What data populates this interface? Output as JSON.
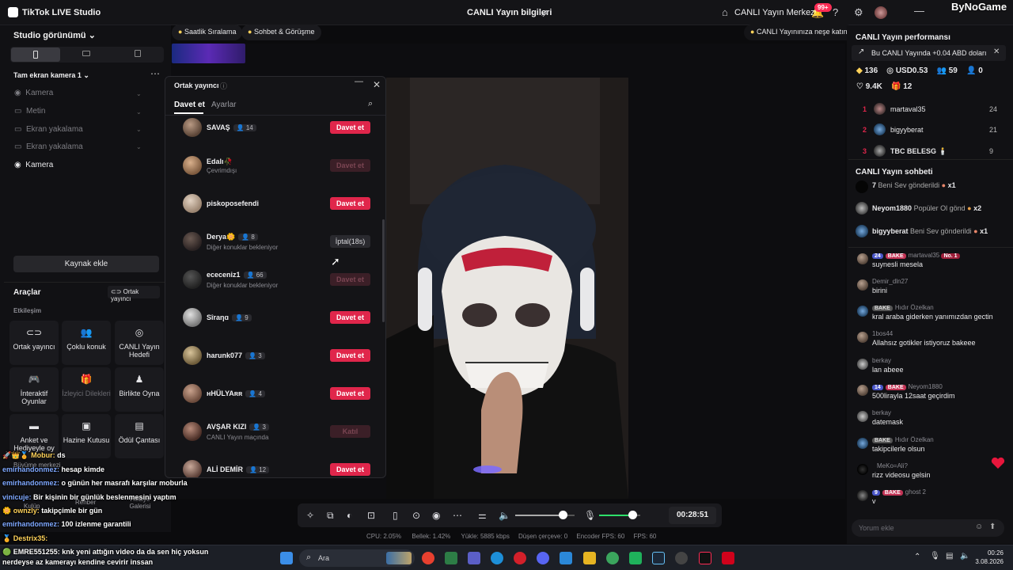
{
  "titlebar": {
    "app_title": "TikTok LIVE Studio",
    "center_title": "CANLI Yayın bilgileri",
    "live_center": "CANLI Yayın Merkezi",
    "notif_badge": "99+",
    "watermark": "ByNoGame"
  },
  "left_panel": {
    "studio_view": "Studio görünümü",
    "scene_name": "Tam ekran kamera 1",
    "sources": [
      "Kamera",
      "Metin",
      "Ekran yakalama",
      "Ekran yakalama",
      "Kamera"
    ],
    "add_source": "Kaynak ekle",
    "tools_title": "Araçlar",
    "cohost_link": "Ortak yayıncı",
    "engagement_title": "Etkileşim",
    "tools": [
      {
        "label": "Ortak yayıncı",
        "icon": "link-icon"
      },
      {
        "label": "Çoklu konuk",
        "icon": "people-icon"
      },
      {
        "label": "CANLI Yayın Hedefi",
        "icon": "target-icon"
      },
      {
        "label": "İnteraktif Oyunlar",
        "icon": "gamepad-icon"
      },
      {
        "label": "İzleyici Dilekleri",
        "icon": "gift-icon"
      },
      {
        "label": "Birlikte Oyna",
        "icon": "controller-icon"
      },
      {
        "label": "Anket ve Hediyeyle oy",
        "icon": "poll-icon"
      },
      {
        "label": "Hazine Kutusu",
        "icon": "chest-icon"
      },
      {
        "label": "Ödül Çantası",
        "icon": "bag-icon"
      }
    ],
    "hidden_tools": [
      "Büyüme merkezi",
      "Kulüp",
      "Rehber",
      "Hediye Galerisi"
    ]
  },
  "top_strip": {
    "hourly_rank": "Saatlik Sıralama",
    "chat_meet": "Sohbet & Görüşme",
    "promo": "CANLI Yayınınıza neşe katın"
  },
  "cohost_dialog": {
    "title": "Ortak yayıncı",
    "tab_invite": "Davet et",
    "tab_settings": "Ayarlar",
    "invite_label": "Davet et",
    "items": [
      {
        "name": "SAVAŞ",
        "count": "14",
        "sub": "",
        "action": "Davet et",
        "state": "active"
      },
      {
        "name": "Edalı🥀",
        "count": "",
        "sub": "Çevrimdışı",
        "action": "Davet et",
        "state": "disabled"
      },
      {
        "name": "piskoposefendi",
        "count": "",
        "sub": "",
        "action": "Davet et",
        "state": "active"
      },
      {
        "name": "Derya🌼",
        "count": "8",
        "sub": "Diğer konuklar bekleniyor",
        "action": "İptal(18s)",
        "state": "cancel"
      },
      {
        "name": "ececeniz1",
        "count": "66",
        "sub": "Diğer konuklar bekleniyor",
        "action": "Davet et",
        "state": "disabled"
      },
      {
        "name": "Sîraηɑ",
        "count": "9",
        "sub": "",
        "action": "Davet et",
        "state": "active"
      },
      {
        "name": "harunk077",
        "count": "3",
        "sub": "",
        "action": "Davet et",
        "state": "active"
      },
      {
        "name": "ʜHÜLYAʀʀ",
        "count": "4",
        "sub": "",
        "action": "Davet et",
        "state": "active"
      },
      {
        "name": "AVŞAR KIZI",
        "count": "3",
        "sub": "CANLI Yayın maçında",
        "action": "Katıl",
        "state": "disabled"
      },
      {
        "name": "ALİ DEMİR",
        "count": "12",
        "sub": "",
        "action": "Davet et",
        "state": "active"
      }
    ]
  },
  "controls": {
    "timer": "00:28:51",
    "stats": {
      "cpu": "CPU: 2.05%",
      "memory": "Bellek: 1.42%",
      "upload": "Yükle: 5885 kbps",
      "dropped": "Düşen çerçeve: 0",
      "encoder": "Encoder FPS: 60",
      "fps": "FPS: 60"
    },
    "volume_level": 0.8,
    "mic_level": 0.8
  },
  "right_panel": {
    "perf_title": "CANLI Yayın performansı",
    "perf_banner": "Bu CANLI Yayında +0.04 ABD doları",
    "metrics": {
      "diamonds": "136",
      "usd": "USD0.53",
      "viewers": "59",
      "new_followers": "0",
      "likes": "9.4K",
      "gifters": "12"
    },
    "ranking": [
      {
        "rank": "1",
        "name": "martaval35",
        "score": "24"
      },
      {
        "rank": "2",
        "name": "bigyyberat",
        "score": "21"
      },
      {
        "rank": "3",
        "name": "TBC BELESG 🕯️",
        "score": "9"
      }
    ],
    "chat_title": "CANLI Yayın sohbeti",
    "gift_events": [
      {
        "name": "7",
        "text": "Beni Sev gönderildi",
        "count": "x1"
      },
      {
        "name": "Neyom1880",
        "text": "Popüler Ol gönd",
        "count": "x2"
      },
      {
        "name": "bigyyberat",
        "text": "Beni Sev gönderildi",
        "count": "x1"
      }
    ],
    "messages": [
      {
        "name": "martaval35",
        "level": "24",
        "fan": "BAKE",
        "extra": "No. 1",
        "text": "suynesli mesela"
      },
      {
        "name": "Demir_dln27",
        "level": "",
        "fan": "",
        "extra": "",
        "text": "birini"
      },
      {
        "name": "Hıdır Özelkan",
        "level": "",
        "fan": "BAKE",
        "extra": "",
        "text": "kral araba giderken yanımızdan gectin"
      },
      {
        "name": "1bos44",
        "level": "",
        "fan": "",
        "extra": "",
        "text": "Allahsız gotikler istiyoruz bakeee"
      },
      {
        "name": "berkay",
        "level": "",
        "fan": "",
        "extra": "",
        "text": "lan abeee"
      },
      {
        "name": "Neyom1880",
        "level": "14",
        "fan": "BAKE",
        "extra": "",
        "text": "500lirayla 12saat geçirdim"
      },
      {
        "name": "berkay",
        "level": "",
        "fan": "",
        "extra": "",
        "text": "datemask"
      },
      {
        "name": "Hıdır Özelkan",
        "level": "",
        "fan": "BAKE",
        "extra": "",
        "text": "takipcilerle olsun"
      },
      {
        "name": "MeKo=Ali?",
        "level": "",
        "fan": "",
        "extra": "",
        "text": "rizz videosu gelsin"
      },
      {
        "name": "ghost 2",
        "level": "9",
        "fan": "BAKE",
        "extra": "",
        "text": "v"
      }
    ],
    "comment_placeholder": "Yorum ekle"
  },
  "overlay_chat": [
    {
      "name": "Mobur:",
      "text": "ds"
    },
    {
      "name": "emirhandonmez:",
      "text": "hesap kimde"
    },
    {
      "name": "emirhandonmez:",
      "text": "o günün her masrafı karşılar moburla"
    },
    {
      "name": "vinicuje:",
      "text": "Bir kişinin bir günlük beslenmesini yaptım"
    },
    {
      "name": "ownzly:",
      "text": "takipçimle bir gün"
    },
    {
      "name": "emirhandonmez:",
      "text": "100 izlenme garantili"
    },
    {
      "name": "Destrix35:",
      "text": ""
    },
    {
      "name": "EMRE551255:",
      "text": "knk yeni attığın video da da sen hiç yoksun"
    },
    {
      "name": "",
      "text": "nerdeyse az kamerayı kendine cevirir inssan"
    }
  ],
  "taskbar": {
    "search_placeholder": "Ara",
    "time": "00:26",
    "date": "3.08.2026"
  }
}
